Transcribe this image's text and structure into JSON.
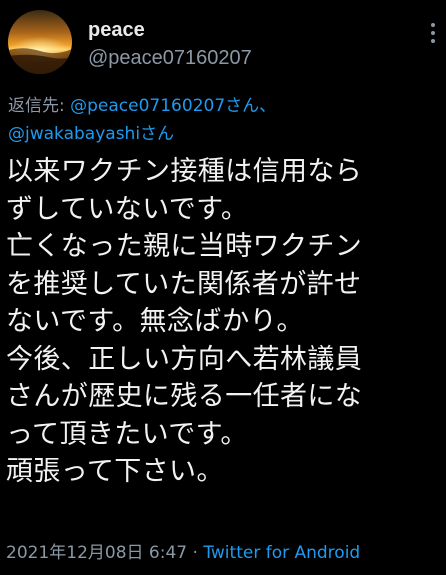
{
  "author": {
    "display_name": "peace",
    "handle": "@peace07160207"
  },
  "reply": {
    "prefix": "返信先: ",
    "mention_1": "@peace07160207さん、",
    "mention_2": "@jwakabayashiさん"
  },
  "tweet": {
    "lines": [
      "以来ワクチン接種は信用なら",
      "ずしていないです。",
      "亡くなった親に当時ワクチン",
      "を推奨していた関係者が許せ",
      "ないです。無念ばかり。",
      "今後、正しい方向へ若林議員",
      "さんが歴史に残る一任者にな",
      "って頂きたいです。",
      "頑張って下さい。"
    ]
  },
  "meta": {
    "timestamp": "2021年12月08日 6:47",
    "separator": " · ",
    "source": "Twitter for Android"
  },
  "icons": {
    "avatar": "sunset-avatar",
    "more": "more-options-icon"
  },
  "colors": {
    "background": "#000000",
    "link": "#1d9bf0",
    "secondary_text": "#8b98a5",
    "primary_text": "#e7e9ea"
  }
}
